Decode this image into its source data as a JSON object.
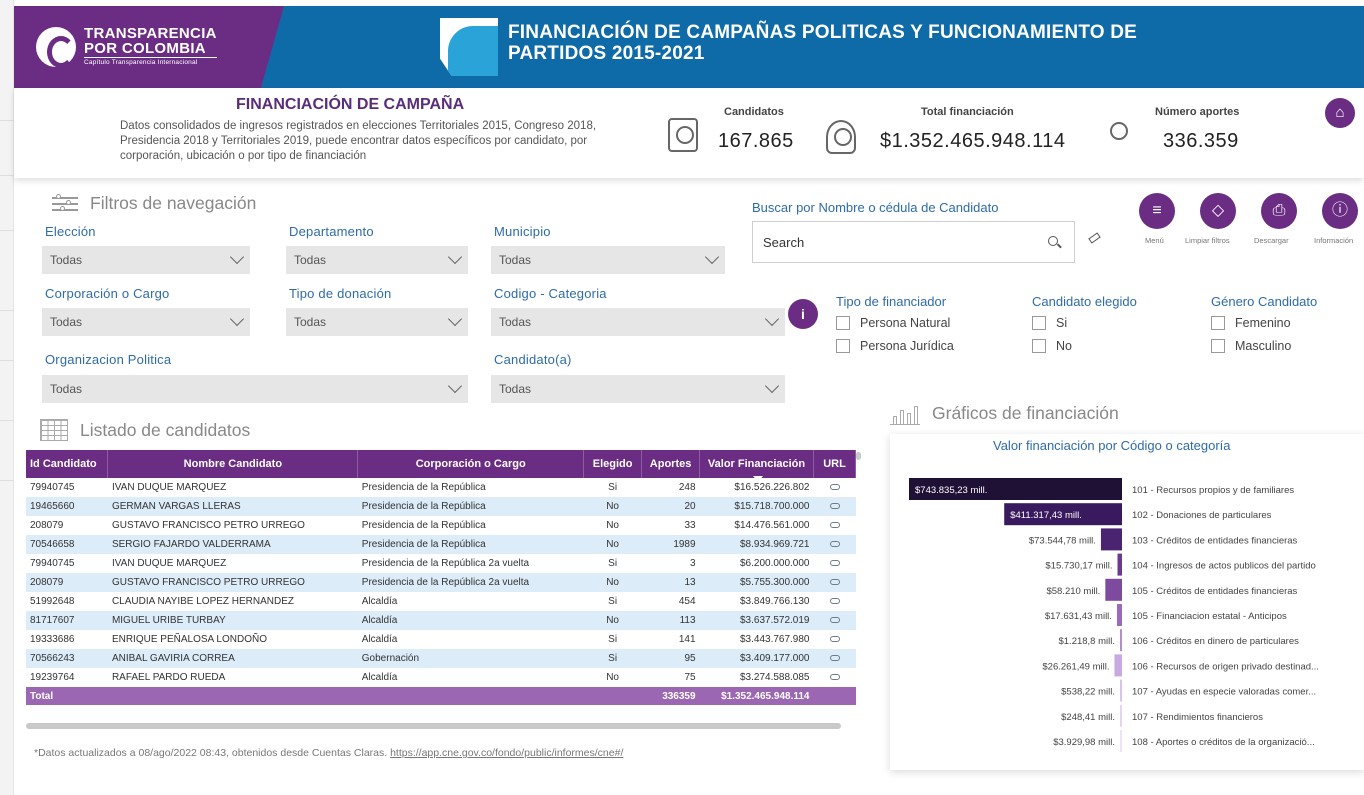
{
  "header": {
    "logo_line1": "TRANSPARENCIA",
    "logo_line2": "POR COLOMBIA",
    "logo_line3": "Capítulo Transparencia Internacional",
    "title_line1": "FINANCIACIÓN DE CAMPAÑAS POLITICAS Y FUNCIONAMIENTO DE",
    "title_line2": "PARTIDOS 2015-2021"
  },
  "summary": {
    "section_title": "FINANCIACIÓN DE CAMPAÑA",
    "description": "Datos consolidados de ingresos registrados en elecciones Territoriales 2015, Congreso 2018, Presidencia 2018 y Territoriales 2019, puede encontrar datos específicos por candidato, por corporación, ubicación o por tipo de financiación",
    "stats": [
      {
        "label": "Candidatos",
        "value": "167.865"
      },
      {
        "label": "Total financiación",
        "value": "$1.352.465.948.114"
      },
      {
        "label": "Número aportes",
        "value": "336.359"
      }
    ]
  },
  "filters": {
    "title": "Filtros de navegación",
    "eleccion": {
      "label": "Elección",
      "value": "Todas"
    },
    "departamento": {
      "label": "Departamento",
      "value": "Todas"
    },
    "municipio": {
      "label": "Municipio",
      "value": "Todas"
    },
    "corporacion": {
      "label": "Corporación o Cargo",
      "value": "Todas"
    },
    "tipo_donacion": {
      "label": "Tipo de donación",
      "value": "Todas"
    },
    "codigo": {
      "label": "Codigo - Categoria",
      "value": "Todas"
    },
    "organizacion": {
      "label": "Organizacion Politica",
      "value": "Todas"
    },
    "candidato": {
      "label": "Candidato(a)",
      "value": "Todas"
    }
  },
  "search": {
    "label": "Buscar por Nombre o cédula de Candidato",
    "placeholder": "Search"
  },
  "actions": {
    "menu": "Menú",
    "limpiar": "Limpiar filtros",
    "descargar": "Descargar",
    "informacion": "Información"
  },
  "checks": {
    "tipo_financiador": {
      "title": "Tipo de financiador",
      "options": [
        "Persona Natural",
        "Persona Jurídica"
      ]
    },
    "candidato_elegido": {
      "title": "Candidato elegido",
      "options": [
        "Si",
        "No"
      ]
    },
    "genero": {
      "title": "Género Candidato",
      "options": [
        "Femenino",
        "Masculino"
      ]
    }
  },
  "table": {
    "title": "Listado de candidatos",
    "columns": [
      "Id Candidato",
      "Nombre Candidato",
      "Corporación o Cargo",
      "Elegido",
      "Aportes",
      "Valor Financiación",
      "URL"
    ],
    "rows": [
      [
        "79940745",
        "IVAN DUQUE MARQUEZ",
        "Presidencia de la República",
        "Si",
        "248",
        "$16.526.226.802"
      ],
      [
        "19465660",
        "GERMAN VARGAS LLERAS",
        "Presidencia de la República",
        "No",
        "20",
        "$15.718.700.000"
      ],
      [
        "208079",
        "GUSTAVO FRANCISCO PETRO URREGO",
        "Presidencia de la República",
        "No",
        "33",
        "$14.476.561.000"
      ],
      [
        "70546658",
        "SERGIO FAJARDO VALDERRAMA",
        "Presidencia de la República",
        "No",
        "1989",
        "$8.934.969.721"
      ],
      [
        "79940745",
        "IVAN DUQUE MARQUEZ",
        "Presidencia de la República 2a vuelta",
        "Si",
        "3",
        "$6.200.000.000"
      ],
      [
        "208079",
        "GUSTAVO FRANCISCO PETRO URREGO",
        "Presidencia de la República 2a vuelta",
        "No",
        "13",
        "$5.755.300.000"
      ],
      [
        "51992648",
        "CLAUDIA NAYIBE LOPEZ HERNANDEZ",
        "Alcaldía",
        "Si",
        "454",
        "$3.849.766.130"
      ],
      [
        "81717607",
        "MIGUEL URIBE TURBAY",
        "Alcaldía",
        "No",
        "113",
        "$3.637.572.019"
      ],
      [
        "19333686",
        "ENRIQUE PEÑALOSA LONDOÑO",
        "Alcaldía",
        "Si",
        "141",
        "$3.443.767.980"
      ],
      [
        "70566243",
        "ANIBAL GAVIRIA CORREA",
        "Gobernación",
        "Si",
        "95",
        "$3.409.177.000"
      ],
      [
        "19239764",
        "RAFAEL PARDO RUEDA",
        "Alcaldía",
        "No",
        "75",
        "$3.274.588.085"
      ]
    ],
    "total_label": "Total",
    "total_aportes": "336359",
    "total_valor": "$1.352.465.948.114"
  },
  "footnote": {
    "text": "*Datos actualizados a 08/ago/2022 08:43, obtenidos desde Cuentas Claras. ",
    "link": "https://app.cne.gov.co/fondo/public/informes/cne#/"
  },
  "charts_section": {
    "title": "Gráficos de financiación"
  },
  "chart_data": {
    "type": "bar",
    "orientation": "horizontal",
    "title": "Valor financiación por Código o categoría",
    "unit": "mill.",
    "categories": [
      "101 - Recursos propios y de familiares",
      "102 - Donaciones de particulares",
      "103 - Créditos de entidades financieras",
      "104 - Ingresos de actos publicos del partido",
      "105 - Créditos de entidades financieras",
      "105 - Financiacion estatal - Anticipos",
      "106 - Créditos en dinero de particulares",
      "106 - Recursos de origen privado destinad...",
      "107 - Ayudas en especie valoradas comer...",
      "107 - Rendimientos financieros",
      "108 - Aportes o créditos de la organizació..."
    ],
    "values": [
      743835.23,
      411317.43,
      73544.78,
      15730.17,
      58210,
      17631.43,
      1218.8,
      26261.49,
      538.22,
      248.41,
      3929.98
    ],
    "value_labels": [
      "$743.835,23 mill.",
      "$411.317,43 mill.",
      "$73.544,78 mill.",
      "$15.730,17 mill.",
      "$58.210 mill.",
      "$17.631,43 mill.",
      "$1.218,8 mill.",
      "$26.261,49 mill.",
      "$538,22 mill.",
      "$248,41 mill.",
      "$3.929,98 mill."
    ],
    "colors": [
      "#1f1036",
      "#3a1a5e",
      "#4a2470",
      "#6b3a8f",
      "#7d4a9e",
      "#9b6bbb",
      "#b48ccf",
      "#c9a9e0",
      "#d9c3ec",
      "#e4d4f2",
      "#ede2f6"
    ]
  }
}
